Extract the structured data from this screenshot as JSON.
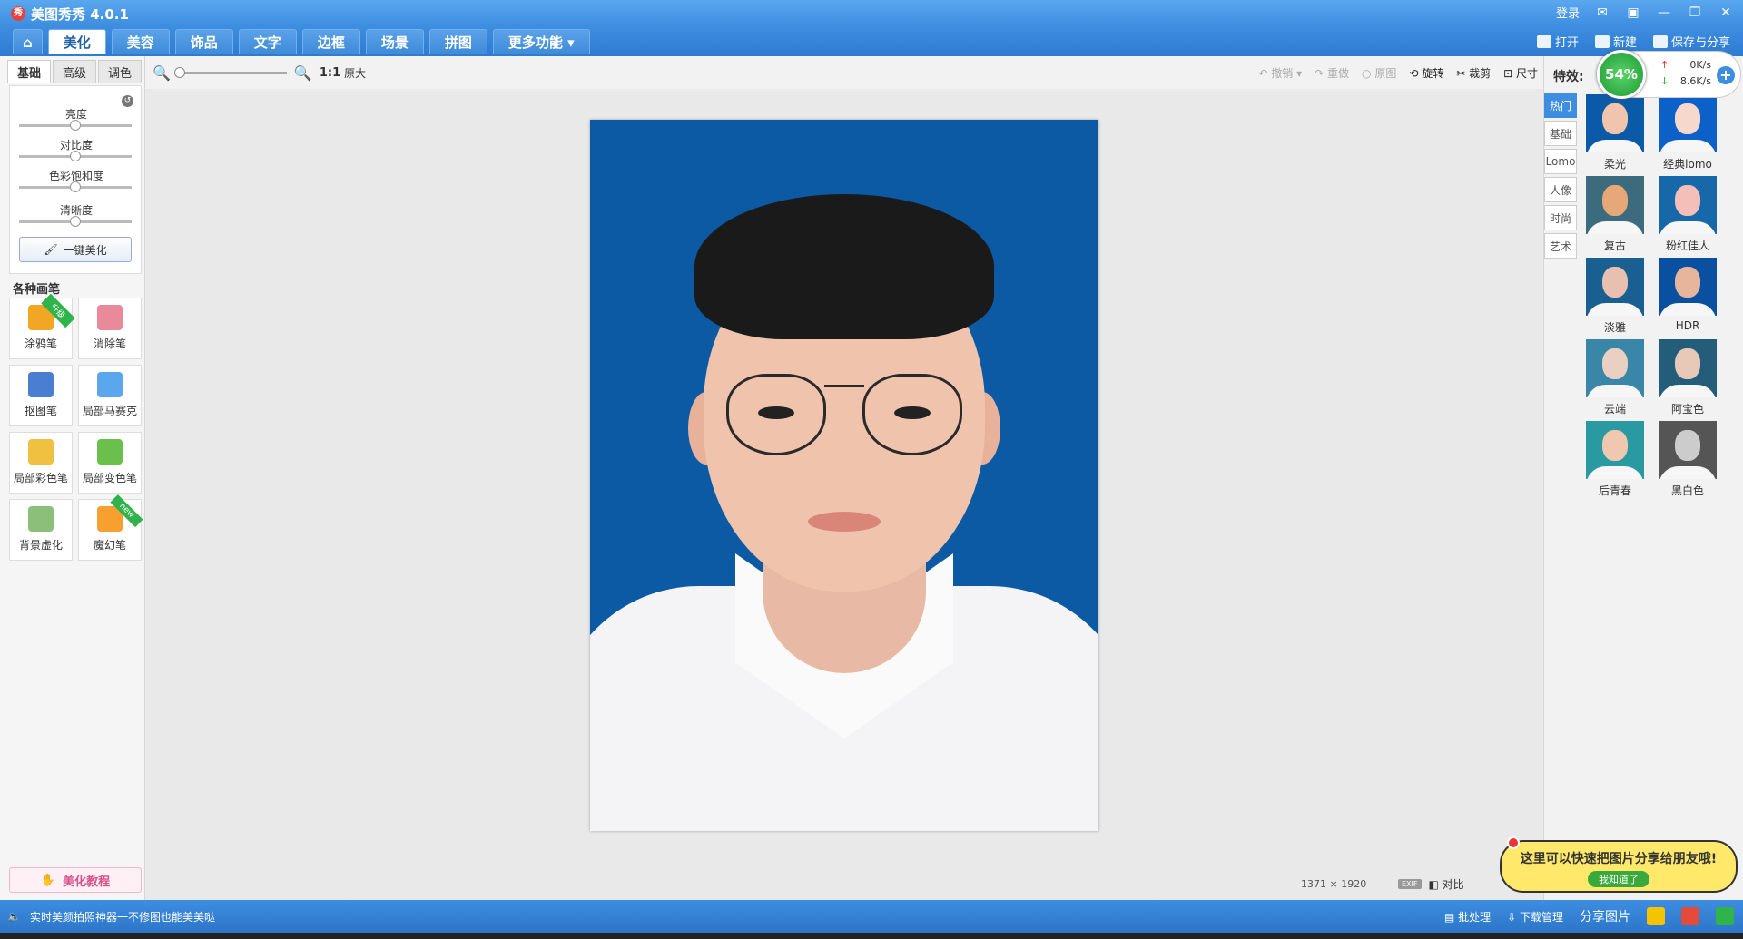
{
  "window": {
    "title": "美图秀秀 4.0.1",
    "login": "登录",
    "logo_glyph": "秀"
  },
  "menu": {
    "tabs": [
      {
        "label": "美化"
      },
      {
        "label": "美容"
      },
      {
        "label": "饰品"
      },
      {
        "label": "文字"
      },
      {
        "label": "边框"
      },
      {
        "label": "场景"
      },
      {
        "label": "拼图"
      },
      {
        "label": "更多功能 ▾"
      }
    ],
    "right": {
      "open": "打开",
      "new": "新建",
      "save": "保存与分享"
    }
  },
  "subbar": {
    "ratio": "1:1",
    "original": "原大",
    "undo": "撤销",
    "redo": "重做",
    "original_img": "原图",
    "rotate": "旋转",
    "crop": "裁剪",
    "size": "尺寸"
  },
  "left": {
    "tabs": [
      {
        "label": "基础"
      },
      {
        "label": "高级"
      },
      {
        "label": "调色"
      }
    ],
    "adjust": [
      {
        "label": "亮度"
      },
      {
        "label": "对比度"
      },
      {
        "label": "色彩饱和度"
      },
      {
        "label": "清晰度"
      }
    ],
    "onekey": "一键美化",
    "brush_title": "各种画笔",
    "brushes": [
      {
        "label": "涂鸦笔",
        "ribbon": "升级",
        "color": "#f2a623"
      },
      {
        "label": "消除笔",
        "ribbon": "",
        "color": "#e88a9a"
      },
      {
        "label": "抠图笔",
        "ribbon": "",
        "color": "#4a7ed0"
      },
      {
        "label": "局部马赛克",
        "ribbon": "",
        "color": "#5aa7ee"
      },
      {
        "label": "局部彩色笔",
        "ribbon": "",
        "color": "#f0c040"
      },
      {
        "label": "局部变色笔",
        "ribbon": "",
        "color": "#6ac04a"
      },
      {
        "label": "背景虚化",
        "ribbon": "",
        "color": "#8cbf7a"
      },
      {
        "label": "魔幻笔",
        "ribbon": "new",
        "color": "#f7a030"
      }
    ],
    "tutorial": "美化教程"
  },
  "canvas": {
    "dimensions": {
      "w": "1371",
      "x": "×",
      "h": "1920"
    },
    "exif": "EXIF",
    "compare": "对比"
  },
  "right": {
    "fx_label": "特效:",
    "categories": [
      {
        "label": "热门"
      },
      {
        "label": "基础"
      },
      {
        "label": "Lomo"
      },
      {
        "label": "人像"
      },
      {
        "label": "时尚"
      },
      {
        "label": "艺术"
      }
    ],
    "effects": [
      {
        "label": "柔光",
        "bg": "#0a5aa8",
        "skin": "#f0c4ad"
      },
      {
        "label": "经典lomo",
        "bg": "#0c61c8",
        "skin": "#f6d9cc"
      },
      {
        "label": "复古",
        "bg": "#3b6b7d",
        "skin": "#e6a878"
      },
      {
        "label": "粉红佳人",
        "bg": "#1668a8",
        "skin": "#f4bfb8"
      },
      {
        "label": "淡雅",
        "bg": "#1a5f92",
        "skin": "#e8c0b0"
      },
      {
        "label": "HDR",
        "bg": "#0950a0",
        "skin": "#e7b49c"
      },
      {
        "label": "云端",
        "bg": "#3a86a8",
        "skin": "#e9d0c2"
      },
      {
        "label": "阿宝色",
        "bg": "#245d7a",
        "skin": "#e8c9b8"
      },
      {
        "label": "后青春",
        "bg": "#2a9aa2",
        "skin": "#f0c8b0"
      },
      {
        "label": "黑白色",
        "bg": "#555555",
        "skin": "#cccccc"
      }
    ]
  },
  "speed": {
    "percent": "54%",
    "up": "0K/s",
    "down": "8.6K/s"
  },
  "share_bubble": {
    "text": "这里可以快速把图片分享给朋友哦!",
    "ok": "我知道了"
  },
  "status": {
    "left": "实时美颜拍照神器一不修图也能美美哒",
    "batch": "批处理",
    "download": "下载管理",
    "share": "分享图片"
  }
}
